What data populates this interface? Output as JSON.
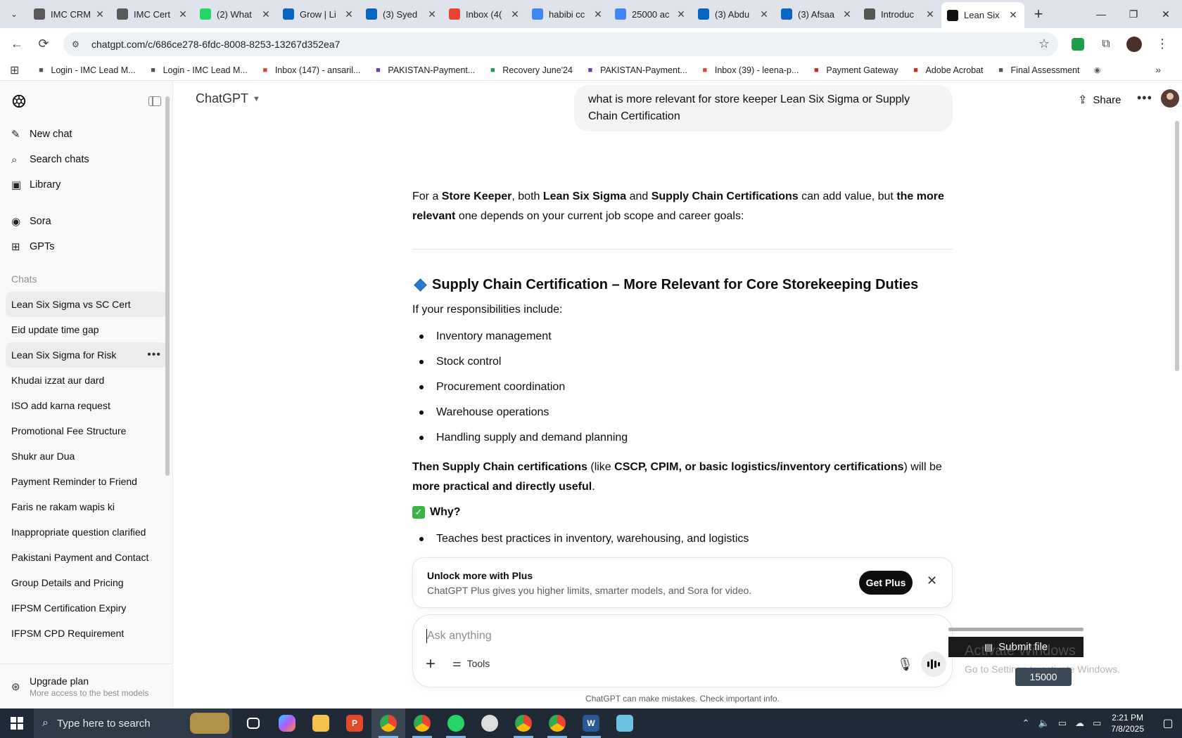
{
  "browser": {
    "tabs": [
      {
        "title": "IMC CRM",
        "favicon": "imc-icon",
        "color": "#5a5a5a"
      },
      {
        "title": "IMC Cert",
        "favicon": "imc-icon",
        "color": "#5a5a5a"
      },
      {
        "title": "(2) What",
        "favicon": "whatsapp-icon",
        "color": "#25d366"
      },
      {
        "title": "Grow | Li",
        "favicon": "linkedin-icon",
        "color": "#0a66c2"
      },
      {
        "title": "(3) Syed",
        "favicon": "linkedin-icon",
        "color": "#0a66c2"
      },
      {
        "title": "Inbox (4(",
        "favicon": "gmail-icon",
        "color": "#ea4335"
      },
      {
        "title": "habibi cc",
        "favicon": "google-icon",
        "color": "#4285f4"
      },
      {
        "title": "25000 ac",
        "favicon": "google-icon",
        "color": "#4285f4"
      },
      {
        "title": "(3) Abdu",
        "favicon": "linkedin-icon",
        "color": "#0a66c2"
      },
      {
        "title": "(3) Afsaa",
        "favicon": "linkedin-icon",
        "color": "#0a66c2"
      },
      {
        "title": "Introduc",
        "favicon": "openai-icon",
        "color": "#555555"
      },
      {
        "title": "Lean Six",
        "favicon": "chatgpt-icon",
        "color": "#111111"
      }
    ],
    "url": "chatgpt.com/c/686ce278-6fdc-8008-8253-13267d352ea7",
    "bookmarks": [
      {
        "label": "Login - IMC Lead M...",
        "icon": "imc-icon"
      },
      {
        "label": "Login - IMC Lead M...",
        "icon": "imc-icon"
      },
      {
        "label": "Inbox (147) - ansaril...",
        "icon": "gmail-icon"
      },
      {
        "label": "PAKISTAN-Payment...",
        "icon": "forms-icon"
      },
      {
        "label": "Recovery June'24",
        "icon": "sheets-icon"
      },
      {
        "label": "PAKISTAN-Payment...",
        "icon": "forms-icon"
      },
      {
        "label": "Inbox (39) - leena-p...",
        "icon": "gmail-icon"
      },
      {
        "label": "Payment Gateway",
        "icon": "acrobat-icon"
      },
      {
        "label": "Adobe Acrobat",
        "icon": "acrobat-icon"
      },
      {
        "label": "Final Assessment",
        "icon": "imc-icon"
      }
    ]
  },
  "sidebar": {
    "nav": [
      {
        "label": "New chat",
        "icon": "new-chat-icon"
      },
      {
        "label": "Search chats",
        "icon": "search-icon"
      },
      {
        "label": "Library",
        "icon": "library-icon"
      }
    ],
    "nav2": [
      {
        "label": "Sora",
        "icon": "sora-icon"
      },
      {
        "label": "GPTs",
        "icon": "gpts-icon"
      }
    ],
    "chats_heading": "Chats",
    "chats": [
      "Lean Six Sigma vs SC Cert",
      "Eid update time gap",
      "Lean Six Sigma for Risk",
      "Khudai izzat aur dard",
      "ISO add karna request",
      "Promotional Fee Structure",
      "Shukr aur Dua",
      "Payment Reminder to Friend",
      "Faris ne rakam wapis ki",
      "Inappropriate question clarified",
      "Pakistani Payment and Contact",
      "Group Details and Pricing",
      "IFPSM Certification Expiry",
      "IFPSM CPD Requirement"
    ],
    "upgrade": {
      "title": "Upgrade plan",
      "subtitle": "More access to the best models"
    }
  },
  "header": {
    "model": "ChatGPT",
    "share": "Share"
  },
  "conversation": {
    "user_message": "what is more relevant for store keeper Lean Six Sigma or Supply Chain Certification",
    "intro": {
      "p1": "For a ",
      "b1": "Store Keeper",
      "p2": ", both ",
      "b2": "Lean Six Sigma",
      "p3": " and ",
      "b3": "Supply Chain Certifications",
      "p4": " can add value, but ",
      "b4": "the more relevant",
      "p5": " one depends on your current job scope and career goals:"
    },
    "section_title": "Supply Chain Certification – More Relevant for Core Storekeeping Duties",
    "section_lead": "If your responsibilities include:",
    "duties": [
      "Inventory management",
      "Stock control",
      "Procurement coordination",
      "Warehouse operations",
      "Handling supply and demand planning"
    ],
    "then": {
      "b1": "Then Supply Chain certifications",
      "p1": " (like ",
      "b2": "CSCP, CPIM, or basic logistics/inventory certifications",
      "p2": ") will be ",
      "b3": "more practical and directly useful",
      "p3": "."
    },
    "why": "Why?",
    "why_items": [
      "Teaches best practices in inventory, warehousing, and logistics"
    ]
  },
  "promo": {
    "title": "Unlock more with Plus",
    "subtitle": "ChatGPT Plus gives you higher limits, smarter models, and Sora for video.",
    "button": "Get Plus"
  },
  "composer": {
    "placeholder": "Ask anything",
    "tools": "Tools"
  },
  "disclaimer": "ChatGPT can make mistakes. Check important info.",
  "overlay": {
    "submit_file": "Submit file",
    "activate_title": "Activate Windows",
    "activate_sub": "Go to Settings to activate Windows.",
    "badge": "15000"
  },
  "taskbar": {
    "search_placeholder": "Type here to search",
    "time": "2:21 PM",
    "date": "7/8/2025"
  }
}
